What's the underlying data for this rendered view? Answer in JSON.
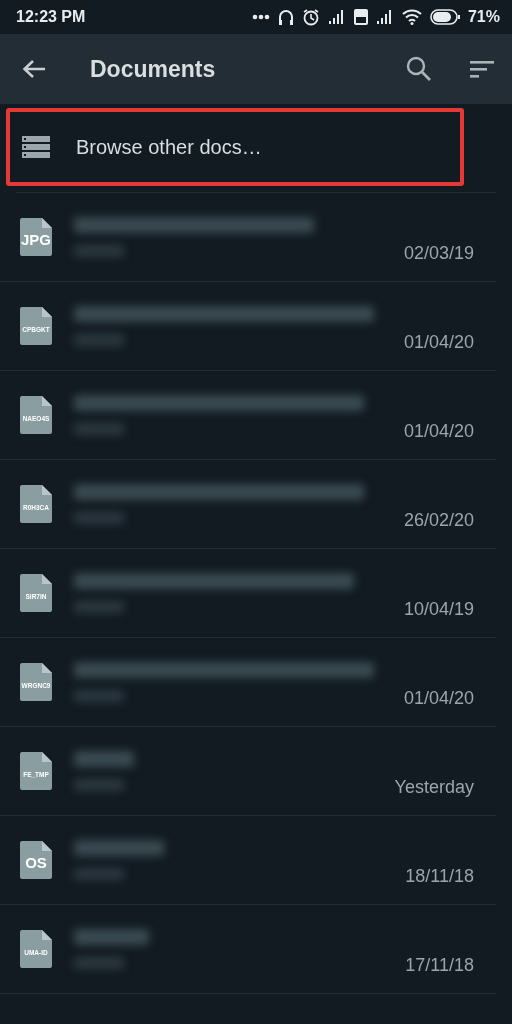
{
  "status_bar": {
    "time": "12:23 PM",
    "battery_text": "71%"
  },
  "app_bar": {
    "title": "Documents"
  },
  "browse_row": {
    "label": "Browse other docs…",
    "highlighted": true
  },
  "files": [
    {
      "icon_label": "JPG",
      "date": "02/03/19"
    },
    {
      "icon_label": "CPBGKT",
      "date": "01/04/20"
    },
    {
      "icon_label": "NAEO4S",
      "date": "01/04/20"
    },
    {
      "icon_label": "R0H3CA",
      "date": "26/02/20"
    },
    {
      "icon_label": "SIR7IN",
      "date": "10/04/19"
    },
    {
      "icon_label": "WRGNC9",
      "date": "01/04/20"
    },
    {
      "icon_label": "FE_TMP",
      "date": "Yesterday"
    },
    {
      "icon_label": "OS",
      "date": "18/11/18"
    },
    {
      "icon_label": "UMA-ID",
      "date": "17/11/18"
    }
  ]
}
